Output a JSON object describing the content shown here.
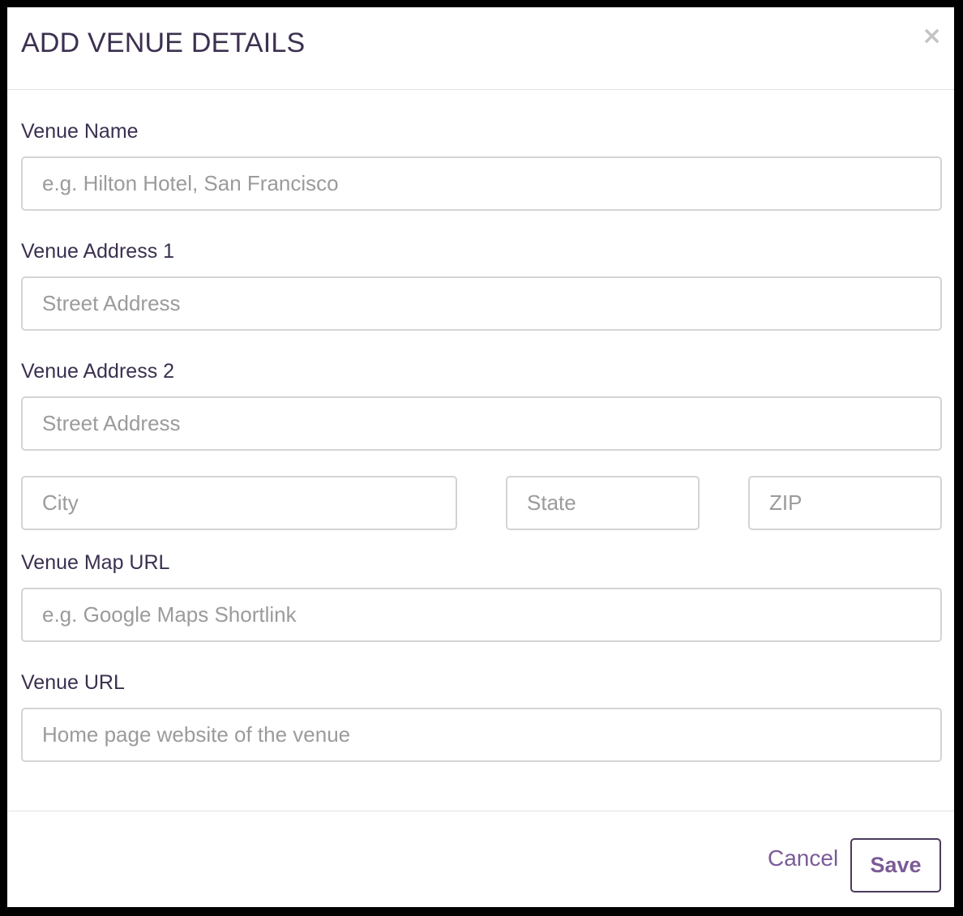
{
  "modal": {
    "title": "ADD VENUE DETAILS",
    "close_label": "×"
  },
  "form": {
    "venue_name": {
      "label": "Venue Name",
      "value": "",
      "placeholder": "e.g. Hilton Hotel, San Francisco"
    },
    "venue_address_1": {
      "label": "Venue Address 1",
      "value": "",
      "placeholder": "Street Address"
    },
    "venue_address_2": {
      "label": "Venue Address 2",
      "value": "",
      "placeholder": "Street Address"
    },
    "city": {
      "value": "",
      "placeholder": "City"
    },
    "state": {
      "value": "",
      "placeholder": "State"
    },
    "zip": {
      "value": "",
      "placeholder": "ZIP"
    },
    "venue_map_url": {
      "label": "Venue Map URL",
      "value": "",
      "placeholder": "e.g. Google Maps Shortlink"
    },
    "venue_url": {
      "label": "Venue URL",
      "value": "",
      "placeholder": "Home page website of the venue"
    }
  },
  "footer": {
    "cancel_label": "Cancel",
    "save_label": "Save"
  },
  "colors": {
    "title_text": "#3c3050",
    "accent_purple": "#7b5b96",
    "input_border": "#d4d4d4",
    "placeholder": "#9b9b9b",
    "backdrop": "#000000"
  }
}
